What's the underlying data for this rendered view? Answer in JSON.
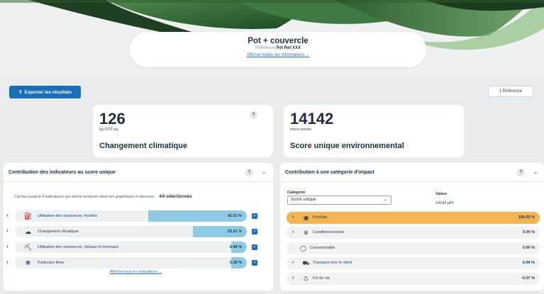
{
  "header": {
    "product_title": "Pot + couvercle",
    "reference_label": "Référence",
    "reference_value": "Pot Ref XXX",
    "show_info_link": "Afficher toutes les informations ⌄"
  },
  "toolbar": {
    "export_label": "Exporter les résultats",
    "export_icon": "share-icon",
    "reference_count_label": "1 Référence"
  },
  "kpis": [
    {
      "value": "126",
      "unit": "kg CO2 eq",
      "name": "Changement climatique"
    },
    {
      "value": "14142",
      "unit": "micro-points",
      "name": "Score unique environnemental"
    }
  ],
  "left_panel": {
    "title": "Contribution des indicateurs au score unique",
    "instruction": "Cochez jusqu'à 4 indicateurs qui seront analysés dans les graphiques ci-dessous",
    "selection_count": "4/4 sélectionnés",
    "indicators": [
      {
        "label": "Utilisation des ressources, fossiles",
        "percent_label": "42.51 %",
        "fill": 0.4251,
        "icon": "fossil-icon",
        "checked": true
      },
      {
        "label": "Changement climatique",
        "percent_label": "23.21 %",
        "fill": 0.2321,
        "icon": "climate-icon",
        "checked": true
      },
      {
        "label": "Utilisation des ressources, métaux et minéraux",
        "percent_label": "6.48 %",
        "fill": 0.0648,
        "icon": "minerals-icon",
        "checked": true
      },
      {
        "label": "Particules fines",
        "percent_label": "5.19 %",
        "fill": 0.0519,
        "icon": "particles-icon",
        "checked": true
      }
    ],
    "show_all_link": "Afficher tous les indicateurs ⌄"
  },
  "right_panel": {
    "title": "Contribution à une catégorie d'impact",
    "category_label": "Catégorie",
    "category_selected": "Score unique",
    "value_label": "Valeur",
    "value_text": "14142 µPt",
    "rows": [
      {
        "label": "Produits",
        "percent_label": "100.03 %",
        "icon": "product-icon",
        "expandable": true,
        "highlight": true
      },
      {
        "label": "Conditionnements",
        "percent_label": "0.00 %",
        "icon": "packaging-icon",
        "expandable": true,
        "highlight": false
      },
      {
        "label": "Consommable",
        "percent_label": "0.00 %",
        "icon": "consumable-icon",
        "expandable": false,
        "highlight": false
      },
      {
        "label": "Transport vers le client",
        "percent_label": "0.04 %",
        "icon": "truck-icon",
        "expandable": true,
        "highlight": false
      },
      {
        "label": "Fin de vie",
        "percent_label": "-0.07 %",
        "icon": "recycle-icon",
        "expandable": true,
        "highlight": false
      }
    ]
  },
  "colors": {
    "primary": "#1a6fb8",
    "bar_fill": "#8fc9e3",
    "highlight_row": "#f2b552"
  }
}
